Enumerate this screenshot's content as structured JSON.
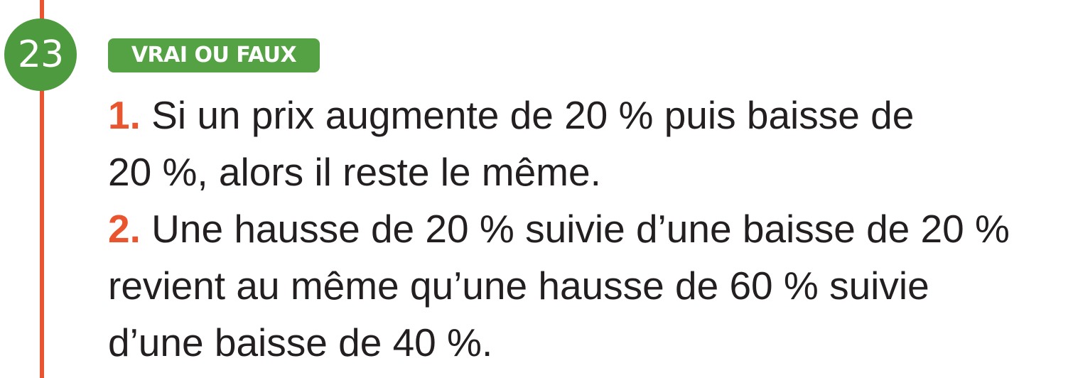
{
  "exercise": {
    "number": "23",
    "badge": "VRAI OU FAUX",
    "colors": {
      "accent_red": "#e8552e",
      "green": "#4e9a3e",
      "text": "#231f20"
    }
  },
  "items": [
    {
      "num": "1.",
      "lines": [
        " Si un prix augmente de 20 % puis baisse de",
        "20 %, alors il reste le même."
      ]
    },
    {
      "num": "2.",
      "lines": [
        " Une hausse de 20 % suivie d’une baisse de 20 %",
        "revient au même qu’une hausse de 60 % suivie",
        "d’une baisse de 40 %."
      ]
    }
  ]
}
